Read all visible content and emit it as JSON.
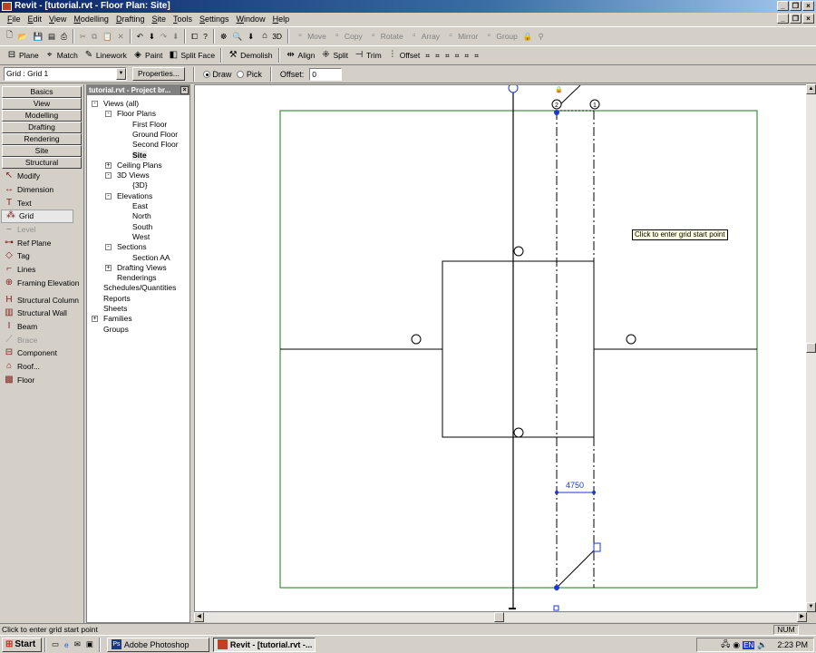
{
  "window": {
    "title": "Revit - [tutorial.rvt - Floor Plan: Site]"
  },
  "menu": [
    "File",
    "Edit",
    "View",
    "Modelling",
    "Drafting",
    "Site",
    "Tools",
    "Settings",
    "Window",
    "Help"
  ],
  "toolbar1": {
    "tools": [
      {
        "label": "Move",
        "icon": "move-icon"
      },
      {
        "label": "Copy",
        "icon": "copy-icon"
      },
      {
        "label": "Rotate",
        "icon": "rotate-icon"
      },
      {
        "label": "Array",
        "icon": "array-icon"
      },
      {
        "label": "Mirror",
        "icon": "mirror-icon"
      },
      {
        "label": "Group",
        "icon": "group-icon"
      }
    ],
    "view3d": "3D"
  },
  "toolbar2": {
    "tools": [
      {
        "label": "Plane",
        "icon": "plane-icon"
      },
      {
        "label": "Match",
        "icon": "match-icon"
      },
      {
        "label": "Linework",
        "icon": "linework-icon"
      },
      {
        "label": "Paint",
        "icon": "paint-icon"
      },
      {
        "label": "Split Face",
        "icon": "split-face-icon"
      },
      {
        "label": "Demolish",
        "icon": "demolish-icon"
      },
      {
        "label": "Align",
        "icon": "align-icon"
      },
      {
        "label": "Split",
        "icon": "split-icon"
      },
      {
        "label": "Trim",
        "icon": "trim-icon"
      },
      {
        "label": "Offset",
        "icon": "offset-icon"
      }
    ]
  },
  "options": {
    "type_selector": "Grid : Grid 1",
    "properties": "Properties...",
    "draw": "Draw",
    "pick": "Pick",
    "mode": "Draw",
    "offset_label": "Offset:",
    "offset_value": "0"
  },
  "design_bar": {
    "tabs": [
      "Basics",
      "View",
      "Modelling",
      "Drafting",
      "Rendering",
      "Site",
      "Structural"
    ],
    "tools": [
      {
        "label": "Modify",
        "enabled": true
      },
      {
        "label": "Dimension",
        "enabled": true
      },
      {
        "label": "Text",
        "enabled": true
      },
      {
        "label": "Grid",
        "enabled": true,
        "selected": true
      },
      {
        "label": "Level",
        "enabled": false
      },
      {
        "label": "Ref Plane",
        "enabled": true
      },
      {
        "label": "Tag",
        "enabled": true
      },
      {
        "label": "Lines",
        "enabled": true
      },
      {
        "label": "Framing Elevation",
        "enabled": true
      },
      {
        "label": "Structural Column",
        "enabled": true
      },
      {
        "label": "Structural Wall",
        "enabled": true
      },
      {
        "label": "Beam",
        "enabled": true
      },
      {
        "label": "Brace",
        "enabled": false
      },
      {
        "label": "Component",
        "enabled": true
      },
      {
        "label": "Roof...",
        "enabled": true
      },
      {
        "label": "Floor",
        "enabled": true
      }
    ]
  },
  "project_browser": {
    "title": "tutorial.rvt - Project br...",
    "nodes": [
      "Views (all)",
      "Floor Plans",
      "First Floor",
      "Ground Floor",
      "Second Floor",
      "Site",
      "Ceiling Plans",
      "3D Views",
      "{3D}",
      "Elevations",
      "East",
      "North",
      "South",
      "West",
      "Sections",
      "Section AA",
      "Drafting Views",
      "Renderings",
      "Schedules/Quantities",
      "Reports",
      "Sheets",
      "Families",
      "Groups"
    ]
  },
  "canvas": {
    "tooltip": "Click to enter grid start point",
    "dimension": "4750",
    "grid_bubbles": [
      "2",
      "1"
    ]
  },
  "status": {
    "text": "Click to enter grid start point",
    "num": "NUM"
  },
  "taskbar": {
    "start": "Start",
    "tasks": [
      "Adobe Photoshop",
      "Revit - [tutorial.rvt -..."
    ],
    "language": "EN",
    "clock": "2:23 PM"
  }
}
